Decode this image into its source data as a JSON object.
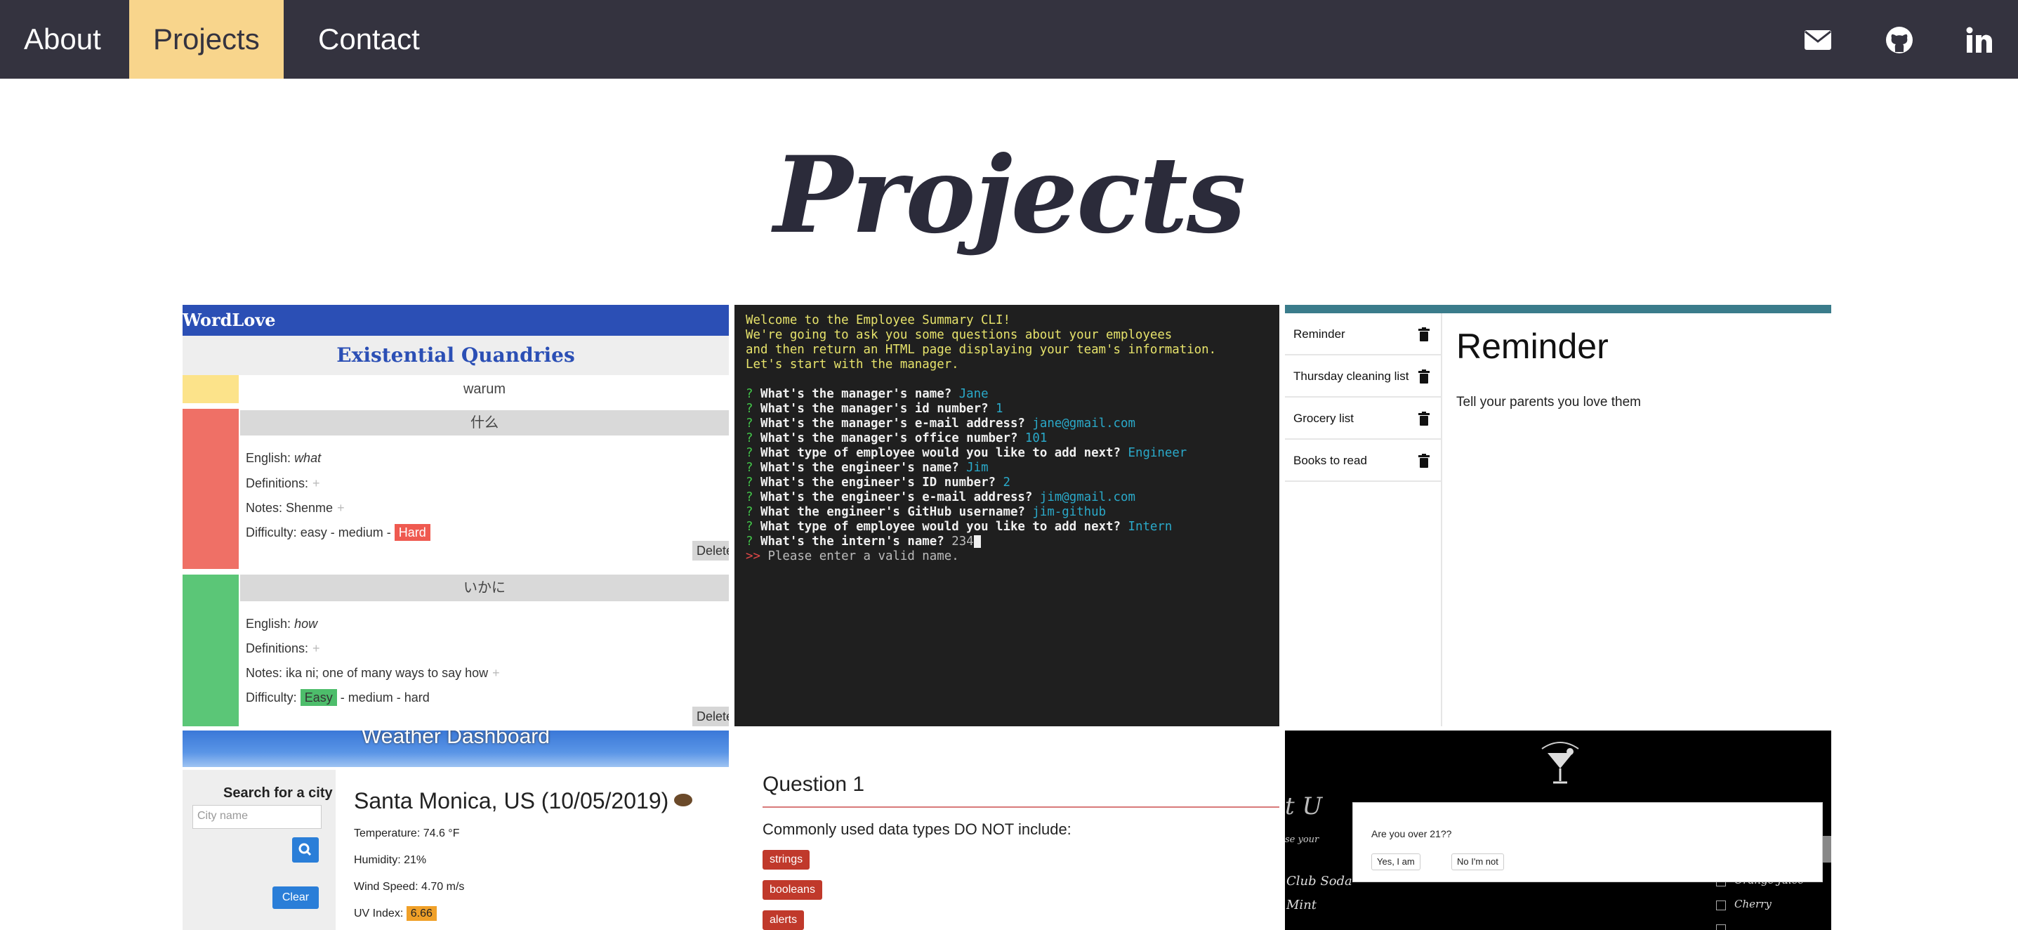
{
  "nav": {
    "links": [
      "About",
      "Projects",
      "Contact"
    ],
    "active": "Projects",
    "icons": [
      "envelope-icon",
      "github-icon",
      "linkedin-icon"
    ],
    "colors": {
      "bar": "#34333f",
      "active": "#f8d58c"
    }
  },
  "page": {
    "title": "Projects"
  },
  "wordlove": {
    "app_name": "WordLove",
    "heading": "Existential Quandries",
    "cards": [
      {
        "word": "warum",
        "color": "#fce38a"
      },
      {
        "word": "什么",
        "color": "#ef7066",
        "english_label": "English:",
        "english": "what",
        "definitions_label": "Definitions:",
        "notes": "Notes: Shenme",
        "difficulty_label": "Difficulty:",
        "difficulty_easy": "easy",
        "difficulty_medium": "- medium -",
        "difficulty_hard": "Hard",
        "delete": "Delete"
      },
      {
        "word": "いかに",
        "color": "#5bc677",
        "english_label": "English:",
        "english": "how",
        "definitions_label": "Definitions:",
        "notes": "Notes: ika ni; one of many ways to say how",
        "difficulty_label": "Difficulty:",
        "difficulty_easy": "Easy",
        "difficulty_rest": "- medium - hard",
        "delete": "Delete"
      }
    ]
  },
  "terminal": {
    "intro": [
      "Welcome to the Employee Summary CLI!",
      "We're going to ask you some questions about your employees",
      "and then return an HTML page displaying your team's information.",
      "Let's start with the manager."
    ],
    "qa": [
      {
        "q": "What's the manager's name?",
        "a": "Jane"
      },
      {
        "q": "What's the manager's id number?",
        "a": "1"
      },
      {
        "q": "What's the manager's e-mail address?",
        "a": "jane@gmail.com"
      },
      {
        "q": "What's the manager's office number?",
        "a": "101"
      },
      {
        "q": "What type of employee would you like to add next?",
        "a": "Engineer"
      },
      {
        "q": "What's the engineer's name?",
        "a": "Jim"
      },
      {
        "q": "What's the engineer's ID number?",
        "a": "2"
      },
      {
        "q": "What's the engineer's e-mail address?",
        "a": "jim@gmail.com"
      },
      {
        "q": "What the engineer's GitHub username?",
        "a": "jim-github"
      },
      {
        "q": "What type of employee would you like to add next?",
        "a": "Intern"
      }
    ],
    "current_q": "What's the intern's name?",
    "current_input": "234",
    "prompt_mark": "?",
    "error_mark": ">>",
    "error": "Please enter a valid name."
  },
  "reminder": {
    "items": [
      "Reminder",
      "Thursday cleaning list",
      "Grocery list",
      "Books to read"
    ],
    "title": "Reminder",
    "body": "Tell your parents you love them"
  },
  "weather": {
    "banner": "Weather Dashboard",
    "search_label": "Search for a city",
    "search_placeholder": "City name",
    "clear": "Clear",
    "city": "Santa Monica, US (10/05/2019)",
    "temperature": "Temperature: 74.6 °F",
    "humidity": "Humidity: 21%",
    "wind": "Wind Speed: 4.70 m/s",
    "uv_label": "UV Index:",
    "uv_value": "6.66"
  },
  "quiz": {
    "question_title": "Question 1",
    "question": "Commonly used data types DO NOT include:",
    "answers": [
      "strings",
      "booleans",
      "alerts"
    ]
  },
  "bar": {
    "modal_question": "Are you over 21??",
    "yes": "Yes, I am",
    "no": "No I'm not",
    "bg_items": [
      "Club Soda",
      "Mint",
      "Orange Juice",
      "Cherry"
    ]
  }
}
